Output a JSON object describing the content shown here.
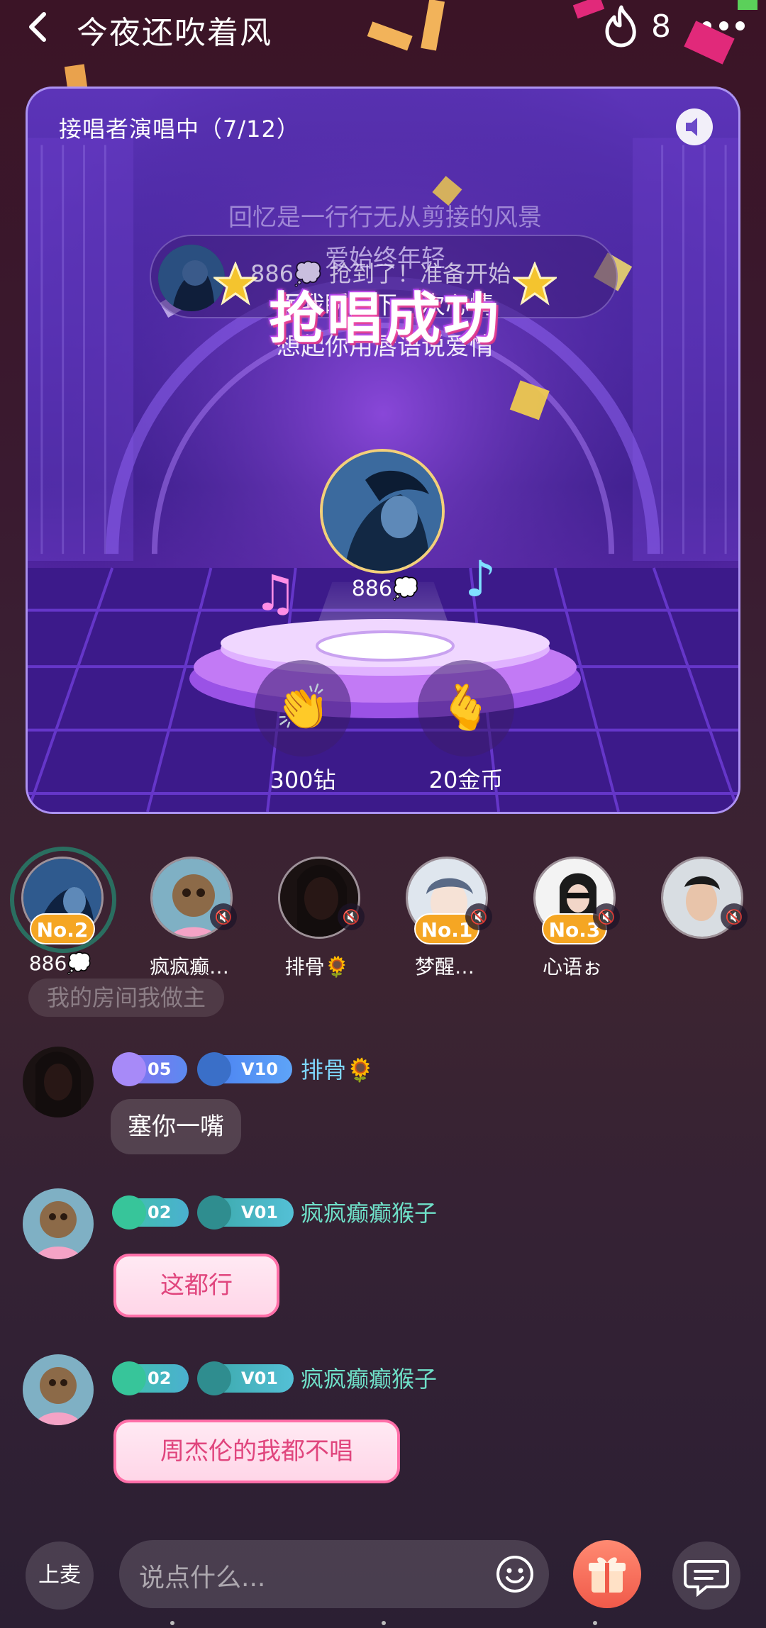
{
  "header": {
    "title": "今夜还吹着风",
    "hot_count": "8"
  },
  "stage": {
    "status": "接唱者演唱中（7/12）",
    "lyrics": [
      "回忆是一行行无从剪接的风景",
      "爱始终年轻",
      "而我瞬间下一次心情",
      "想起你用唇语说爱情"
    ],
    "grab_text": "886💭 抢到了！准备开始",
    "success_banner": "抢唱成功",
    "singer_name": "886💭",
    "clap_label": "300钻",
    "heart_label": "20金币"
  },
  "seats": [
    {
      "name": "886💭",
      "badge": "No.2"
    },
    {
      "name": "疯疯癫…",
      "badge": ""
    },
    {
      "name": "排骨🌻",
      "badge": ""
    },
    {
      "name": "梦醒…",
      "badge": "No.1"
    },
    {
      "name": "心语ぉ",
      "badge": "No.3"
    },
    {
      "name": "",
      "badge": ""
    }
  ],
  "chat": {
    "system_pill": "我的房间我做主",
    "messages": [
      {
        "name": "排骨🌻",
        "level_a": "05",
        "level_b": "10",
        "text": "塞你一嘴"
      },
      {
        "name": "疯疯癫癫猴子",
        "level_a": "02",
        "level_b": "01",
        "text": "这都行"
      },
      {
        "name": "疯疯癫癫猴子",
        "level_a": "02",
        "level_b": "01",
        "text": "周杰伦的我都不唱"
      }
    ]
  },
  "bottom": {
    "mic_label": "上麦",
    "input_placeholder": "说点什么..."
  },
  "colors": {
    "accent_gold": "#f5a623",
    "name_blue": "#7fd7ff",
    "name_teal": "#6fe0c8",
    "pink": "#ff6fa8"
  }
}
